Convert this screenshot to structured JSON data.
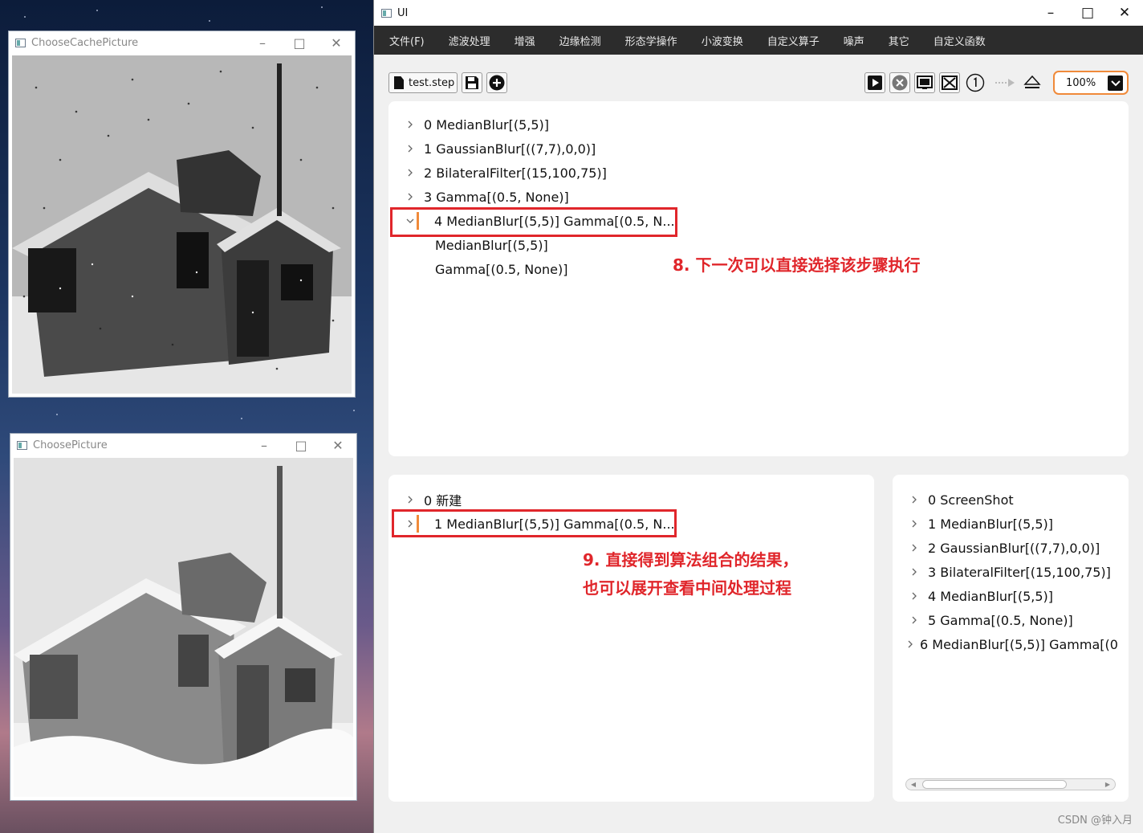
{
  "window1": {
    "title": "ChooseCachePicture",
    "image_label": "house-photo-noisy"
  },
  "window2": {
    "title": "ChoosePicture",
    "image_label": "house-photo-filtered"
  },
  "main": {
    "title": "UI",
    "menu": [
      "文件(F)",
      "滤波处理",
      "增强",
      "边缘检测",
      "形态学操作",
      "小波变换",
      "自定义算子",
      "噪声",
      "其它",
      "自定义函数"
    ],
    "toolbar": {
      "file_label": "test.step",
      "zoom": "100%",
      "icons": [
        "save-icon",
        "add-icon",
        "play-icon",
        "stop-icon",
        "screen-icon",
        "close-screen-icon",
        "step-one-icon",
        "arrow-icon",
        "eject-icon"
      ]
    },
    "top_tree": {
      "items": [
        "0 MedianBlur[(5,5)]",
        "1 GaussianBlur[((7,7),0,0)]",
        "2 BilateralFilter[(15,100,75)]",
        "3 Gamma[(0.5, None)]",
        "4 MedianBlur[(5,5)] Gamma[(0.5, N..."
      ],
      "children": [
        "MedianBlur[(5,5)]",
        "Gamma[(0.5, None)]"
      ]
    },
    "bottom_tree": {
      "items": [
        "0 新建",
        "1 MedianBlur[(5,5)] Gamma[(0.5, N..."
      ]
    },
    "history": {
      "items": [
        "0 ScreenShot",
        "1 MedianBlur[(5,5)]",
        "2 GaussianBlur[((7,7),0,0)]",
        "3 BilateralFilter[(15,100,75)]",
        "4 MedianBlur[(5,5)]",
        "5 Gamma[(0.5, None)]",
        "6 MedianBlur[(5,5)] Gamma[(0.5"
      ]
    }
  },
  "annotations": {
    "a8": "8. 下一次可以直接选择该步骤执行",
    "a9_line1": "9. 直接得到算法组合的结果，",
    "a9_line2": "也可以展开查看中间处理过程"
  },
  "watermark": "CSDN @钟入月",
  "colors": {
    "accent": "#f08a3a",
    "annotation_red": "#e0262b",
    "menubar": "#2c2c2c"
  }
}
